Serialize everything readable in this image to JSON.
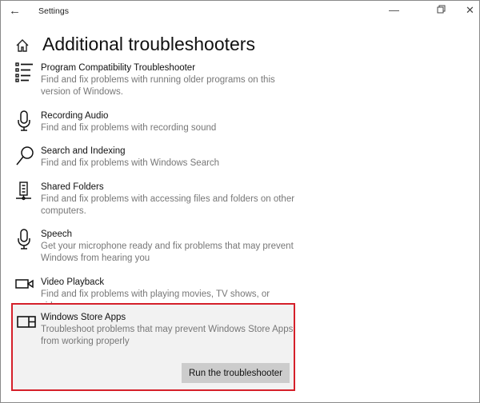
{
  "window": {
    "title": "Settings",
    "back_icon": "back-arrow-icon",
    "minimize": "—",
    "restore": "restore-icon",
    "close": "✕"
  },
  "page": {
    "title": "Additional troubleshooters"
  },
  "items": [
    {
      "title": "Program Compatibility Troubleshooter",
      "desc": "Find and fix problems with running older programs on this version of Windows.",
      "icon": "list-icon"
    },
    {
      "title": "Recording Audio",
      "desc": "Find and fix problems with recording sound",
      "icon": "microphone-icon"
    },
    {
      "title": "Search and Indexing",
      "desc": "Find and fix problems with Windows Search",
      "icon": "search-icon"
    },
    {
      "title": "Shared Folders",
      "desc": "Find and fix problems with accessing files and folders on other computers.",
      "icon": "network-icon"
    },
    {
      "title": "Speech",
      "desc": "Get your microphone ready and fix problems that may prevent Windows from hearing you",
      "icon": "microphone-icon"
    },
    {
      "title": "Video Playback",
      "desc": "Find and fix problems with playing movies, TV shows, or videos",
      "icon": "video-camera-icon"
    }
  ],
  "selected": {
    "title": "Windows Store Apps",
    "desc": "Troubleshoot problems that may prevent Windows Store Apps from working properly",
    "button": "Run the troubleshooter",
    "icon": "store-apps-icon",
    "highlight_color": "#d5202a"
  }
}
